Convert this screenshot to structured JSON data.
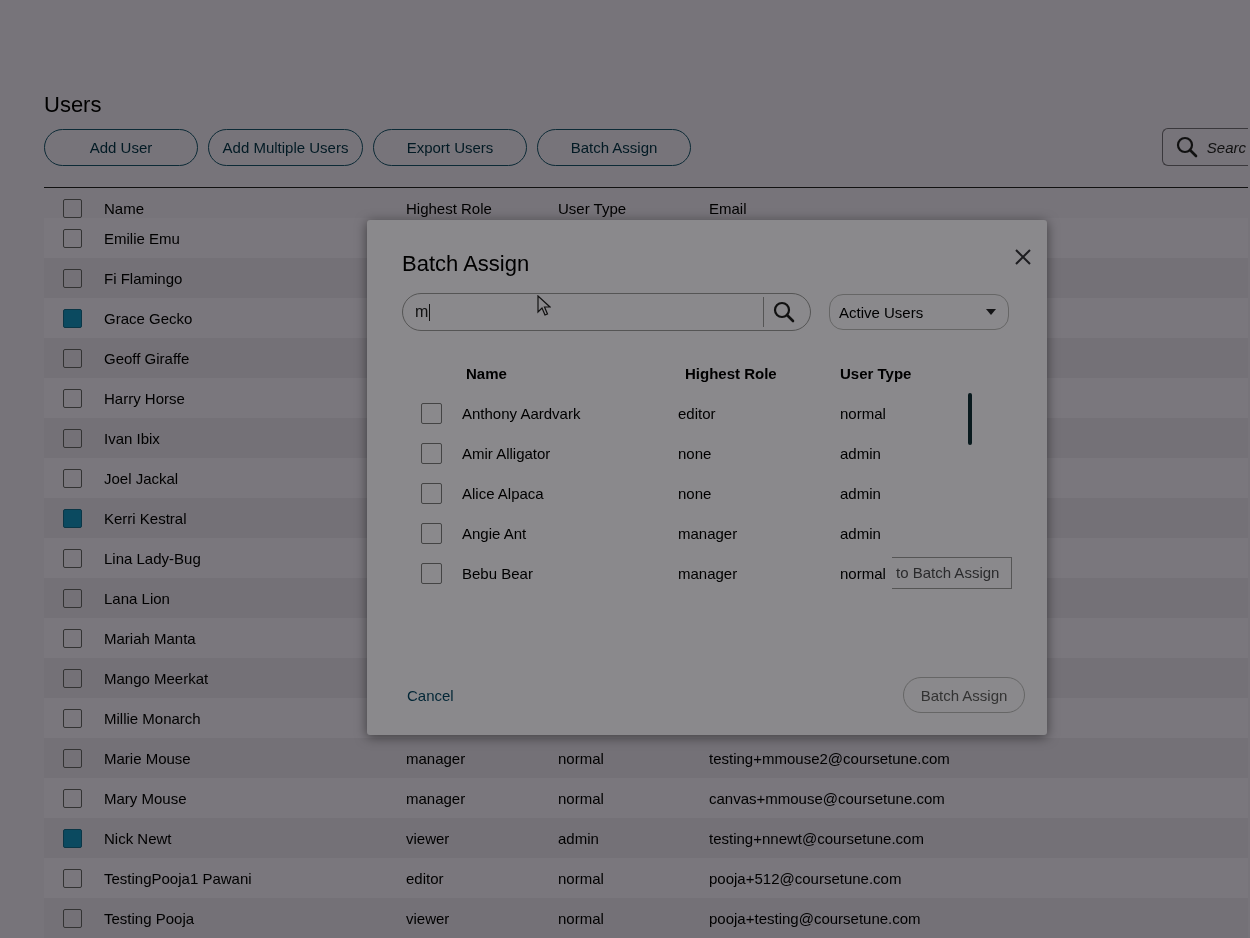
{
  "page": {
    "title": "Users",
    "actions": [
      "Add User",
      "Add Multiple Users",
      "Export Users",
      "Batch Assign"
    ],
    "search": {
      "placeholder": "Searc"
    }
  },
  "table": {
    "all_selected": false,
    "columns": [
      "Name",
      "Highest Role",
      "User Type",
      "Email"
    ],
    "rows": [
      {
        "name": "Emilie Emu",
        "checked": false
      },
      {
        "name": "Fi Flamingo",
        "checked": false
      },
      {
        "name": "Grace Gecko",
        "checked": true
      },
      {
        "name": "Geoff Giraffe",
        "checked": false
      },
      {
        "name": "Harry Horse",
        "checked": false
      },
      {
        "name": "Ivan Ibix",
        "checked": false
      },
      {
        "name": "Joel Jackal",
        "checked": false
      },
      {
        "name": "Kerri Kestral",
        "checked": true
      },
      {
        "name": "Lina Lady-Bug",
        "checked": false
      },
      {
        "name": "Lana Lion",
        "checked": false
      },
      {
        "name": "Mariah Manta",
        "checked": false
      },
      {
        "name": "Mango Meerkat",
        "checked": false
      },
      {
        "name": "Millie Monarch",
        "checked": false
      },
      {
        "name": "Marie Mouse",
        "checked": false,
        "role": "manager",
        "user_type": "normal",
        "email": "testing+mmouse2@coursetune.com"
      },
      {
        "name": "Mary Mouse",
        "checked": false,
        "role": "manager",
        "user_type": "normal",
        "email": "canvas+mmouse@coursetune.com"
      },
      {
        "name": "Nick Newt",
        "checked": true,
        "role": "viewer",
        "user_type": "admin",
        "email": "testing+nnewt@coursetune.com"
      },
      {
        "name": "TestingPooja1 Pawani",
        "checked": false,
        "role": "editor",
        "user_type": "normal",
        "email": "pooja+512@coursetune.com"
      },
      {
        "name": "Testing Pooja",
        "checked": false,
        "role": "viewer",
        "user_type": "normal",
        "email": "pooja+testing@coursetune.com"
      }
    ]
  },
  "modal": {
    "title": "Batch Assign",
    "search": {
      "value": "m"
    },
    "filter": {
      "value": "Active Users"
    },
    "columns": [
      "Name",
      "Highest Role",
      "User Type"
    ],
    "rows": [
      {
        "name": "Anthony Aardvark",
        "role": "editor",
        "user_type": "normal",
        "checked": false
      },
      {
        "name": "Amir Alligator",
        "role": "none",
        "user_type": "admin",
        "checked": false
      },
      {
        "name": "Alice Alpaca",
        "role": "none",
        "user_type": "admin",
        "checked": false
      },
      {
        "name": "Angie Ant",
        "role": "manager",
        "user_type": "admin",
        "checked": false
      },
      {
        "name": "Bebu Bear",
        "role": "manager",
        "user_type": "normal",
        "checked": false
      }
    ],
    "tooltip": "to Batch Assign",
    "cancel": "Cancel",
    "submit": {
      "label": "Batch Assign",
      "disabled": true
    }
  }
}
